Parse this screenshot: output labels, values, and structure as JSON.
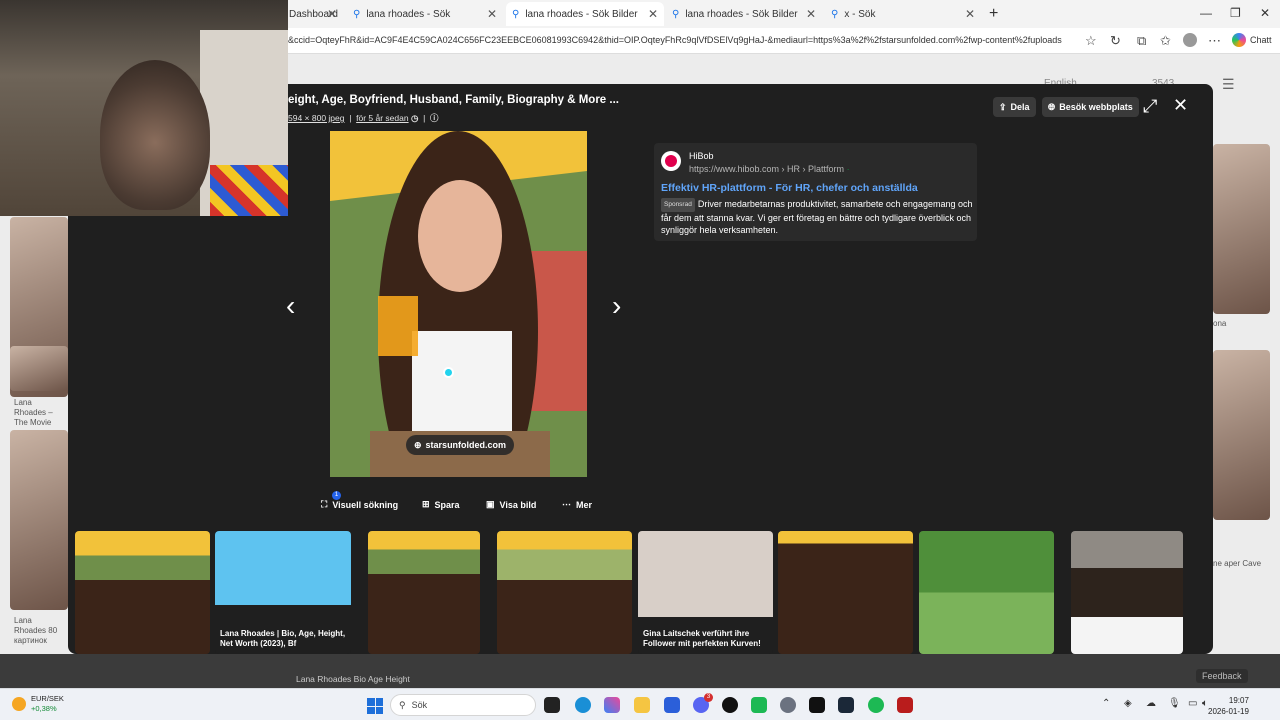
{
  "tabs": [
    {
      "label": "Dashboard",
      "active": false
    },
    {
      "label": "lana rhoades - Sök",
      "active": false
    },
    {
      "label": "lana rhoades - Sök Bilder",
      "active": true
    },
    {
      "label": "lana rhoades - Sök Bilder",
      "active": false
    },
    {
      "label": "x - Sök",
      "active": false
    }
  ],
  "address": {
    "url": "&ccid=OqteyFhR&id=AC9F4E4C59CA024C656FC23EEBCE06081993C6942&thid=OIP.OqteyFhRc9qlVfDSElVq9gHaJ-&mediaurl=https%3a%2f%2fstarsunfolded.com%2fwp-content%2fuploads",
    "copilot_label": "Chatt"
  },
  "modal": {
    "title": "eight, Age, Boyfriend, Husband, Family, Biography & More ...",
    "dimensions": "594 × 800 jpeg",
    "age": "för 5 år sedan",
    "share_label": "Dela",
    "visit_label": "Besök webbplats",
    "source_label": "starsunfolded.com"
  },
  "ad": {
    "brand": "HiBob",
    "url_prefix": "https://www.hibob.com › HR › Plattform",
    "headline": "Effektiv HR-plattform - För HR, chefer och anställda",
    "sponsored": "Sponsrad",
    "body": "Driver medarbetarnas produktivitet, samarbete och engagemang och får dem att stanna kvar. Vi ger ert företag en bättre och tydligare överblick och synliggör hela verksamheten."
  },
  "actions": {
    "visual_search": "Visuell sökning",
    "visual_badge": "1",
    "save": "Spara",
    "view_image": "Visa bild",
    "more": "Mer"
  },
  "related": [
    {
      "caption": ""
    },
    {
      "caption": "Lana Rhoades | Bio, Age, Height, Net Worth (2023), Bf"
    },
    {
      "caption": ""
    },
    {
      "caption": ""
    },
    {
      "caption": "Gina Laitschek verführt ihre Follower mit perfekten Kurven!"
    },
    {
      "caption": ""
    },
    {
      "caption": ""
    },
    {
      "caption": ""
    }
  ],
  "background": {
    "header_lang": "English",
    "header_count": "3543",
    "left_caption_1": "Lana Rhoades – The Movie",
    "left_caption_2": "Lana Rhoades 80 картинок",
    "right_caption_1": "ona",
    "right_caption_2": "ne aper Cave",
    "bottom_caption": "Lana Rhoades Bio Age Height",
    "feedback": "Feedback"
  },
  "taskbar": {
    "widget_title": "EUR/SEK",
    "widget_change": "+0,38%",
    "search_placeholder": "Sök",
    "time": "19:07",
    "date": "2026-01-19",
    "app_badge": "3"
  }
}
